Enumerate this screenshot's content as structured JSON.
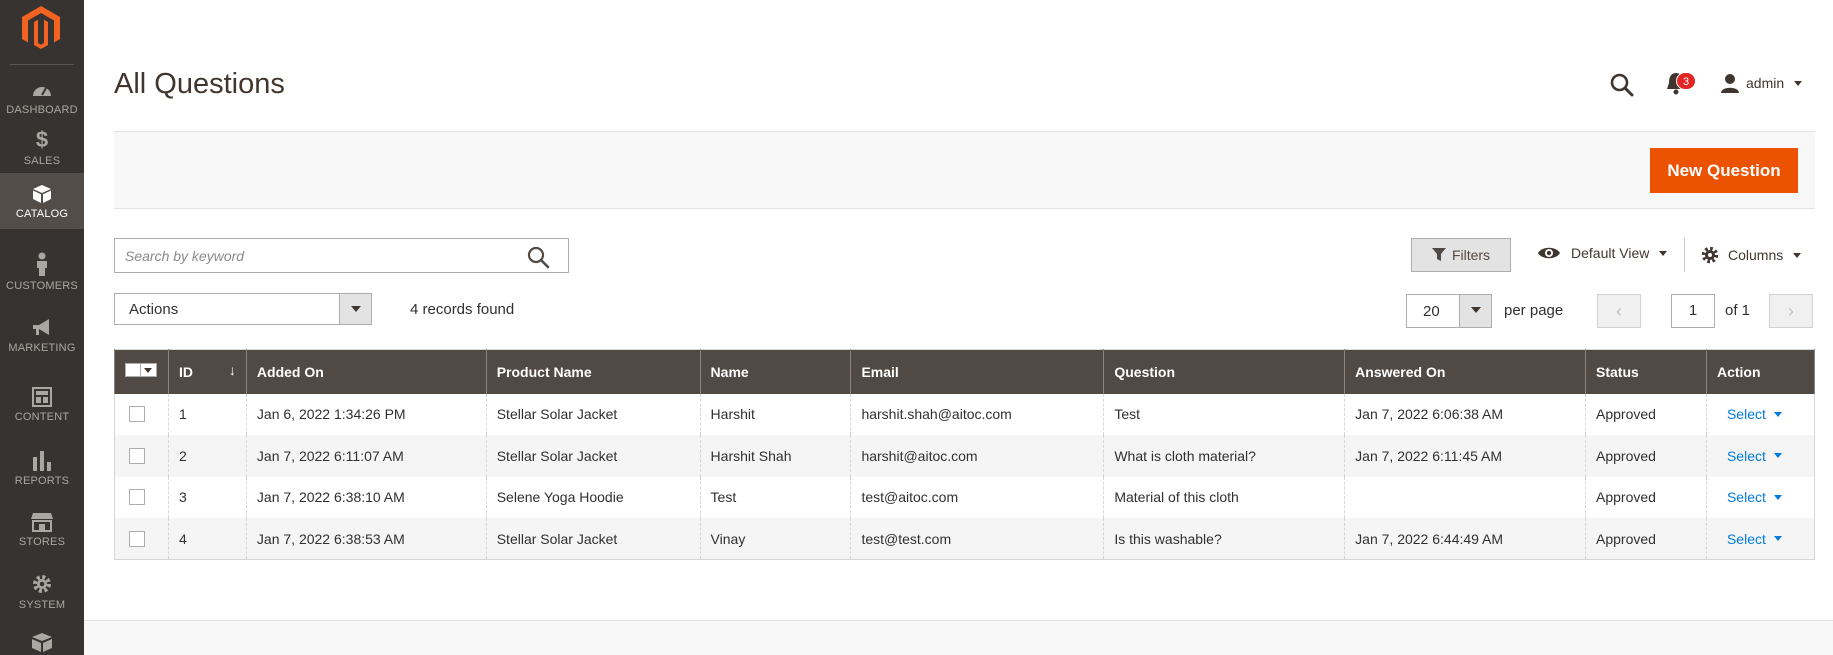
{
  "sidebar": {
    "items": [
      {
        "label": "DASHBOARD",
        "icon": "dashboard-icon"
      },
      {
        "label": "SALES",
        "icon": "dollar-icon"
      },
      {
        "label": "CATALOG",
        "icon": "box-icon"
      },
      {
        "label": "CUSTOMERS",
        "icon": "person-icon"
      },
      {
        "label": "MARKETING",
        "icon": "megaphone-icon"
      },
      {
        "label": "CONTENT",
        "icon": "layout-icon"
      },
      {
        "label": "REPORTS",
        "icon": "bar-chart-icon"
      },
      {
        "label": "STORES",
        "icon": "store-icon"
      },
      {
        "label": "SYSTEM",
        "icon": "gear-icon"
      }
    ],
    "active": "CATALOG"
  },
  "header": {
    "title": "All Questions",
    "notifications": "3",
    "user": "admin"
  },
  "toolbar": {
    "new_label": "New Question"
  },
  "search": {
    "placeholder": "Search by keyword",
    "value": ""
  },
  "controls": {
    "filters_label": "Filters",
    "view_label": "Default View",
    "columns_label": "Columns",
    "actions_label": "Actions",
    "records": "4 records found",
    "per_page_value": "20",
    "per_page_label": "per page",
    "prev": "‹",
    "next": "›",
    "page": "1",
    "of": "of 1"
  },
  "colors": {
    "accent": "#eb5202",
    "sidebar": "#373330",
    "header_row": "#514943",
    "link": "#007bdb"
  },
  "table": {
    "columns": [
      "ID",
      "Added On",
      "Product Name",
      "Name",
      "Email",
      "Question",
      "Answered On",
      "Status",
      "Action"
    ],
    "sort_indicator": "↓",
    "rows": [
      {
        "id": "1",
        "added": "Jan 6, 2022 1:34:26 PM",
        "product": "Stellar Solar Jacket",
        "name": "Harshit",
        "email": "harshit.shah@aitoc.com",
        "question": "Test",
        "answered": "Jan 7, 2022 6:06:38 AM",
        "status": "Approved",
        "action": "Select"
      },
      {
        "id": "2",
        "added": "Jan 7, 2022 6:11:07 AM",
        "product": "Stellar Solar Jacket",
        "name": "Harshit Shah",
        "email": "harshit@aitoc.com",
        "question": "What is cloth material?",
        "answered": "Jan 7, 2022 6:11:45 AM",
        "status": "Approved",
        "action": "Select"
      },
      {
        "id": "3",
        "added": "Jan 7, 2022 6:38:10 AM",
        "product": "Selene Yoga Hoodie",
        "name": "Test",
        "email": "test@aitoc.com",
        "question": "Material of this cloth",
        "answered": "",
        "status": "Approved",
        "action": "Select"
      },
      {
        "id": "4",
        "added": "Jan 7, 2022 6:38:53 AM",
        "product": "Stellar Solar Jacket",
        "name": "Vinay",
        "email": "test@test.com",
        "question": "Is this washable?",
        "answered": "Jan 7, 2022 6:44:49 AM",
        "status": "Approved",
        "action": "Select"
      }
    ]
  }
}
